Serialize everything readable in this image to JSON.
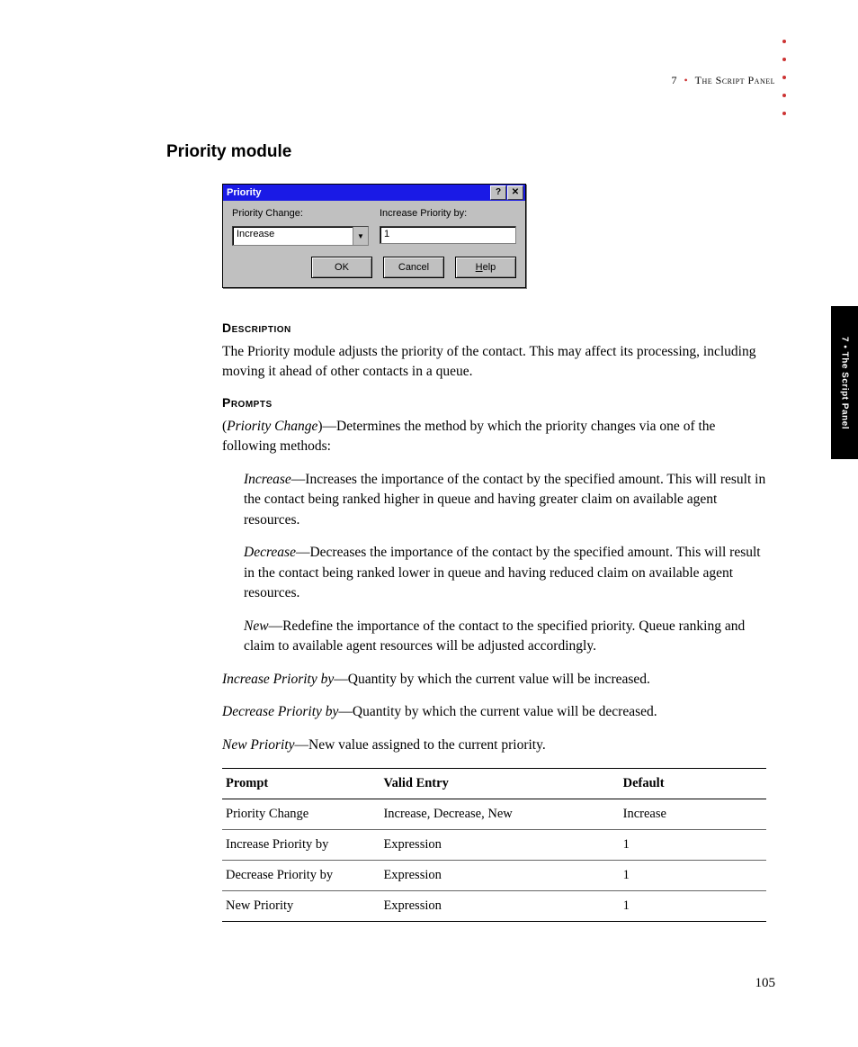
{
  "header": {
    "chapter_num": "7",
    "chapter_title": "The Script Panel"
  },
  "side_tab": "7 • The Script Panel",
  "section_title": "Priority module",
  "dialog": {
    "title": "Priority",
    "help_glyph": "?",
    "close_glyph": "✕",
    "label_priority_change": "Priority Change:",
    "label_increase_by": "Increase Priority by:",
    "combo_value": "Increase",
    "input_value": "1",
    "btn_ok": "OK",
    "btn_cancel": "Cancel",
    "btn_help_prefix": "H",
    "btn_help_rest": "elp"
  },
  "headings": {
    "description": "Description",
    "prompts": "Prompts"
  },
  "text": {
    "description_body": "The Priority module adjusts the priority of the contact. This may affect its processing, including moving it ahead of other contacts in a queue.",
    "pc_open": "(",
    "pc_term": "Priority Change",
    "pc_rest": ")—Determines the method by which the priority changes via one of the following methods:",
    "inc_term": "Increase",
    "inc_rest": "—Increases the importance of the contact by the specified amount. This will result in the contact being ranked higher in queue and having greater claim on available agent resources.",
    "dec_term": "Decrease",
    "dec_rest": "—Decreases the importance of the contact by the specified amount. This will result in the contact being ranked lower in queue and having reduced claim on available agent resources.",
    "new_term": "New",
    "new_rest": "—Redefine the importance of the contact to the specified priority. Queue ranking and claim to available agent resources will be adjusted accordingly.",
    "ipb_term": "Increase Priority by",
    "ipb_rest": "—Quantity by which the current value will be increased.",
    "dpb_term": "Decrease Priority by",
    "dpb_rest": "—Quantity by which the current value will be decreased.",
    "np_term": "New Priority",
    "np_rest": "—New value assigned to the current priority."
  },
  "table": {
    "headers": {
      "c1": "Prompt",
      "c2": "Valid Entry",
      "c3": "Default"
    },
    "rows": [
      {
        "c1": "Priority Change",
        "c2": "Increase, Decrease, New",
        "c3": "Increase"
      },
      {
        "c1": "Increase Priority by",
        "c2": "Expression",
        "c3": "1"
      },
      {
        "c1": "Decrease Priority by",
        "c2": "Expression",
        "c3": "1"
      },
      {
        "c1": "New Priority",
        "c2": "Expression",
        "c3": "1"
      }
    ]
  },
  "page_number": "105"
}
